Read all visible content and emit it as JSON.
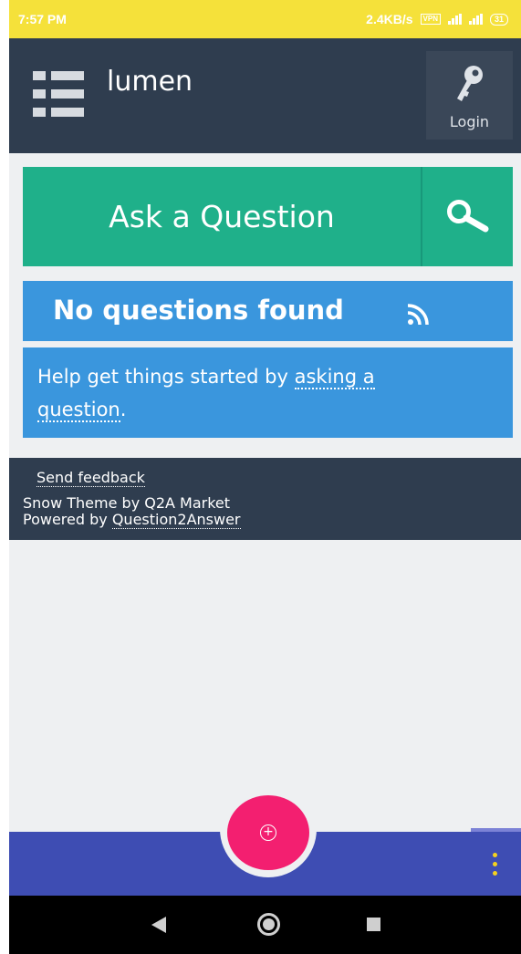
{
  "status_bar": {
    "time": "7:57 PM",
    "net_speed": "2.4KB/s",
    "vpn": "VPN",
    "battery": "31"
  },
  "header": {
    "menu_icon": "list-menu-icon",
    "site_name": "lumen",
    "login_icon": "key-icon",
    "login_label": "Login"
  },
  "ask_bar": {
    "ask_label": "Ask a Question",
    "search_icon": "search-icon"
  },
  "questions": {
    "title": "No questions found",
    "feed_icon": "rss-icon",
    "help_prefix": "Help get things started by ",
    "help_link_part1": "asking a",
    "help_link_part2": "question",
    "help_suffix": "."
  },
  "footer": {
    "feedback": "Send feedback",
    "theme_text": "Snow Theme by Q2A Market",
    "powered_prefix": "Powered by ",
    "powered_link": "Question2Answer"
  },
  "bottom_bar": {
    "fab_icon": "add-circle-icon",
    "menu_icon": "more-vertical-icon"
  },
  "colors": {
    "status_bar": "#f5e13a",
    "header": "#2f3d4f",
    "ask_green": "#1fb08a",
    "info_blue": "#3a96dd",
    "bottom_bar": "#3e4db3",
    "fab": "#f31f70",
    "kebab": "#f5d21f"
  }
}
